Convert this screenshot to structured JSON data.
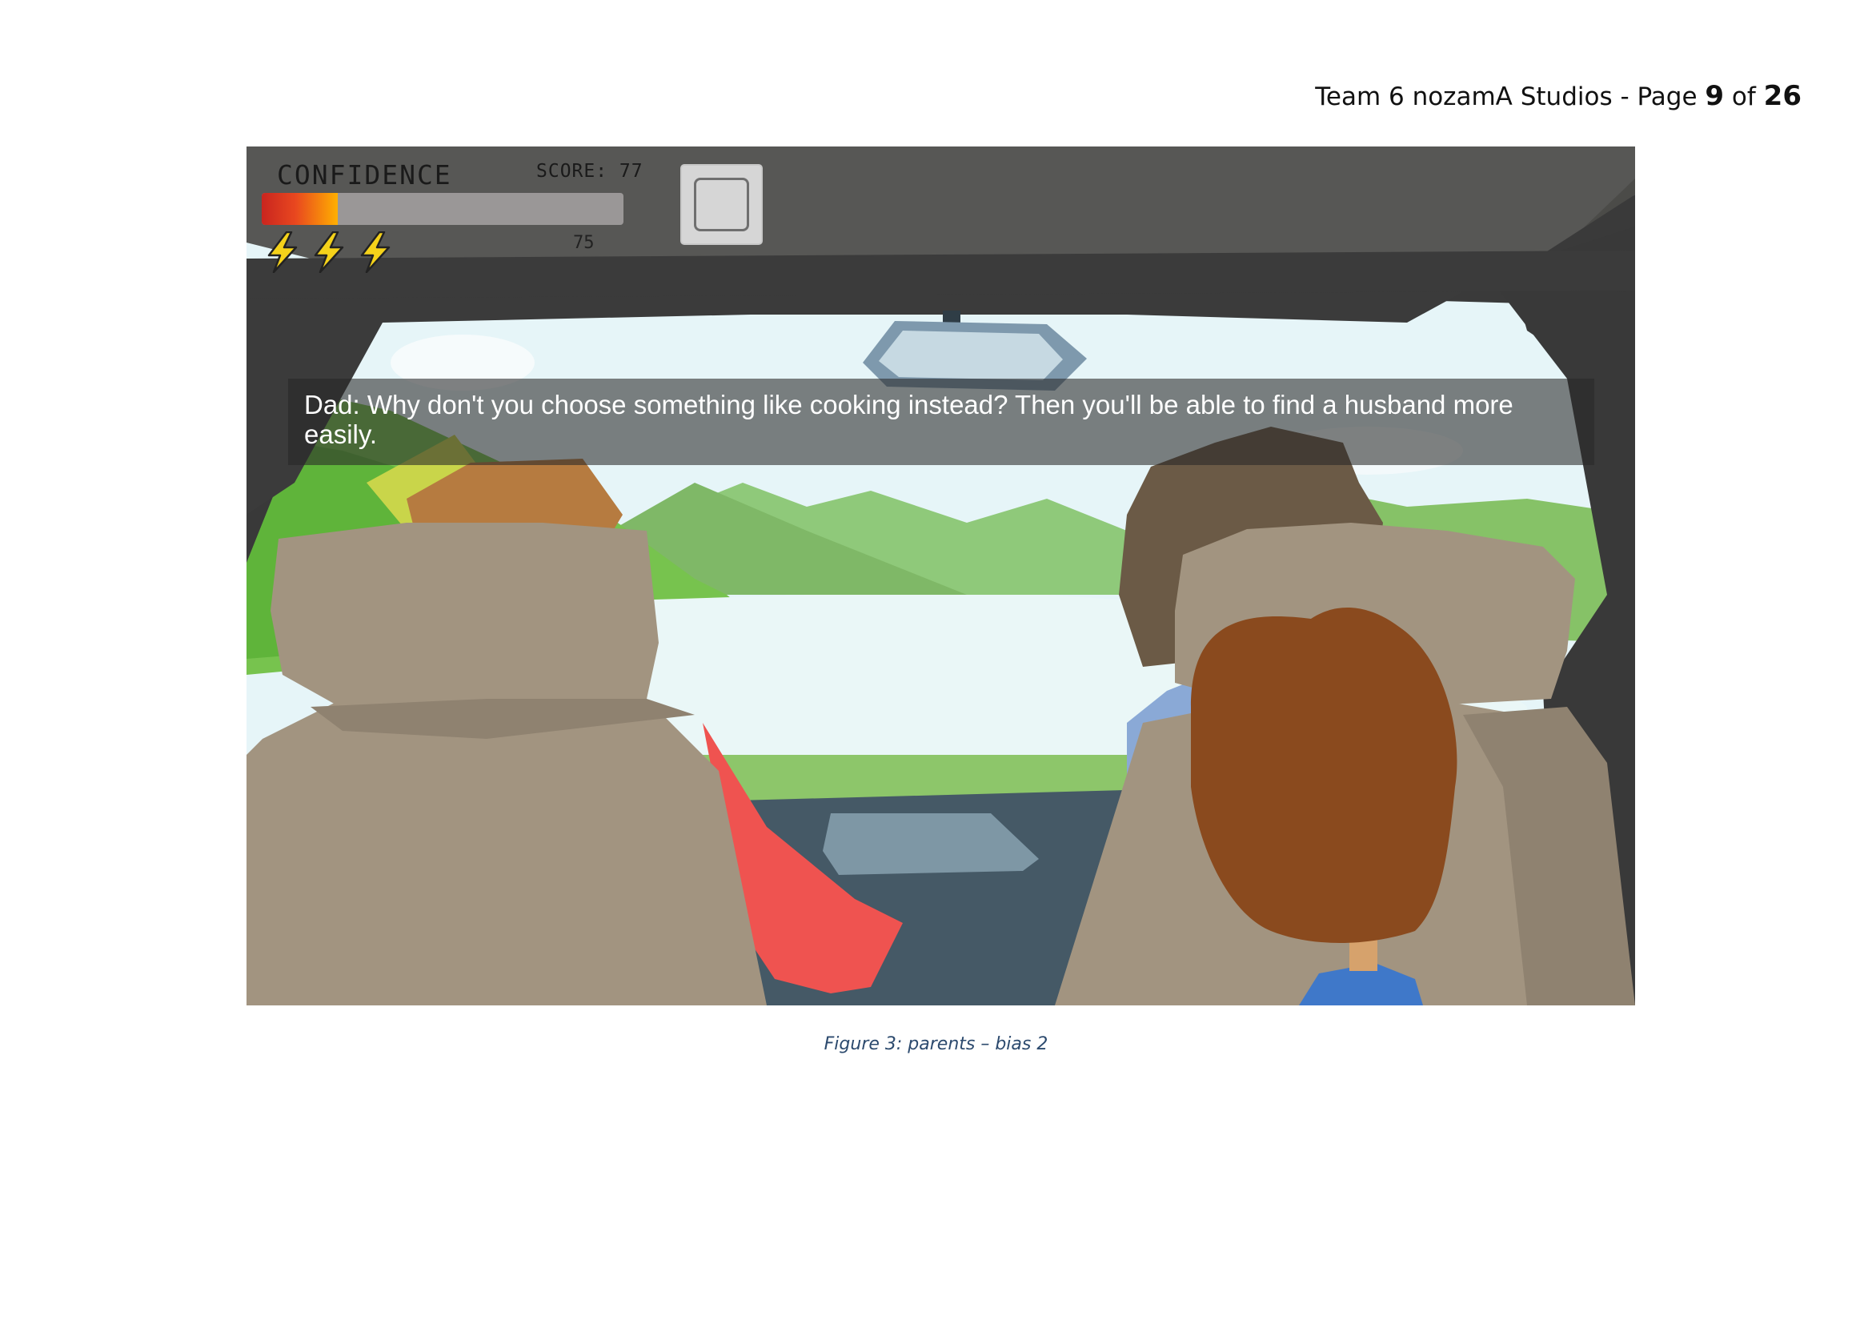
{
  "header": {
    "prefix": "Team 6 nozamA Studios - Page ",
    "page": "9",
    "of": " of ",
    "total": "26"
  },
  "game": {
    "confidence_label": "CONFIDENCE",
    "score_text": "SCORE: 77",
    "confidence_value": "75",
    "confidence_fill_fraction": 0.21,
    "lives": 3,
    "lives_icon": "lightning-bolt-icon",
    "pause_icon": "pause-square-icon",
    "dialogue": "Dad: Why don't you choose something like cooking instead? Then you'll be able to find a husband more easily.",
    "colors": {
      "bar_fill_start": "#c9251f",
      "bar_fill_end": "#ffb000",
      "bar_track": "#9a9797",
      "bolt": "#f5d21a"
    }
  },
  "caption": "Figure 3: parents – bias 2"
}
